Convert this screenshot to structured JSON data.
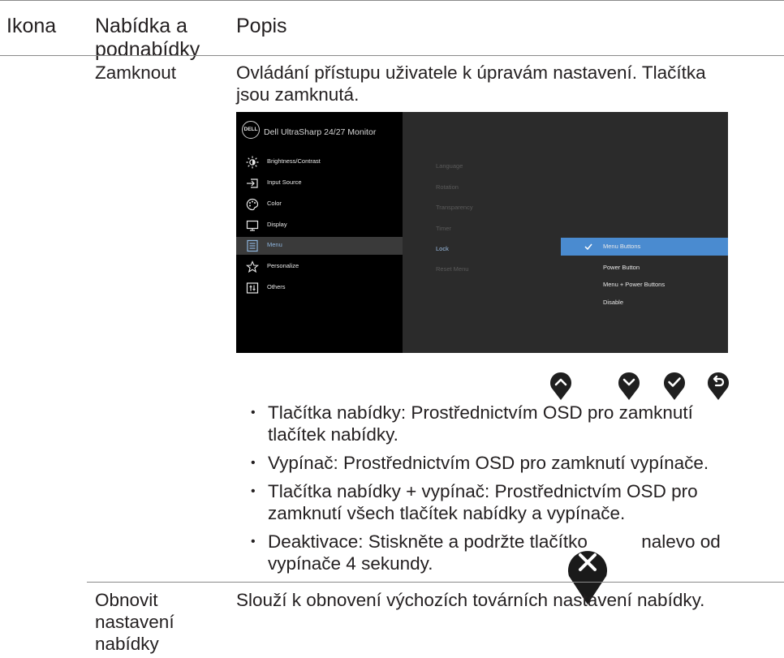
{
  "table": {
    "headers": {
      "icon": "Ikona",
      "menu": "Nabídka a podnabídky",
      "desc": "Popis"
    },
    "row_lock": {
      "name": "Zamknout",
      "description": "Ovládání přístupu uživatele k úpravám nastavení. Tlačítka jsou zamknutá."
    },
    "row_reset": {
      "name": "Obnovit nastavení nabídky",
      "description": "Slouží k obnovení výchozích továrních nastavení nabídky."
    }
  },
  "osd": {
    "logo": "DELL",
    "title": "Dell UltraSharp 24/27 Monitor",
    "menu_items": [
      {
        "label": "Brightness/Contrast",
        "icon": "brightness-icon"
      },
      {
        "label": "Input Source",
        "icon": "input-source-icon"
      },
      {
        "label": "Color",
        "icon": "color-palette-icon"
      },
      {
        "label": "Display",
        "icon": "display-monitor-icon"
      },
      {
        "label": "Menu",
        "icon": "menu-list-icon",
        "selected": true
      },
      {
        "label": "Personalize",
        "icon": "star-icon"
      },
      {
        "label": "Others",
        "icon": "others-icon"
      }
    ],
    "submenu": [
      "Language",
      "Rotation",
      "Transparency",
      "Timer",
      "Lock",
      "Reset Menu"
    ],
    "lock_options": [
      "Menu Buttons",
      "Power Button",
      "Menu + Power Buttons",
      "Disable"
    ],
    "active_submenu": "Lock",
    "selected_option": "Menu Buttons",
    "colors": {
      "panel": "#2b2b2b",
      "left": "#000000",
      "highlight": "#4a8bd0"
    }
  },
  "buttons": [
    "up-arrow-icon",
    "down-arrow-icon",
    "check-icon",
    "back-icon"
  ],
  "bullets": [
    "Tlačítka nabídky: Prostřednictvím OSD pro zamknutí tlačítek nabídky.",
    "Vypínač: Prostřednictvím OSD pro zamknutí vypínače.",
    "Tlačítka nabídky + vypínač: Prostřednictvím OSD pro zamknutí všech tlačítek nabídky a vypínače."
  ],
  "last_bullet": {
    "before": "Deaktivace: Stiskněte a podržte tlačítko",
    "after": "nalevo od vypínače 4 sekundy.",
    "icon": "close-icon"
  }
}
